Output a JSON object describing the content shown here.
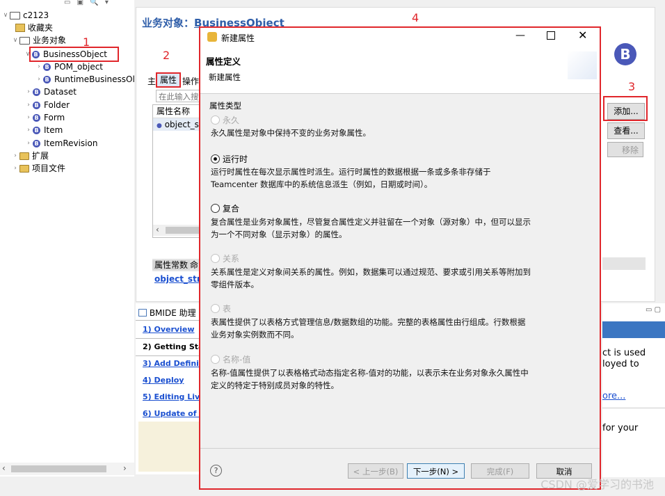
{
  "tree": {
    "root": "c2123",
    "items": [
      {
        "label": "收藏夹"
      },
      {
        "label": "业务对象"
      },
      {
        "label": "BusinessObject"
      },
      {
        "label": "POM_object"
      },
      {
        "label": "RuntimeBusinessOl"
      },
      {
        "label": "Dataset"
      },
      {
        "label": "Folder"
      },
      {
        "label": "Form"
      },
      {
        "label": "Item"
      },
      {
        "label": "ItemRevision"
      },
      {
        "label": "扩展"
      },
      {
        "label": "项目文件"
      }
    ]
  },
  "editor": {
    "title_prefix": "业务对象：",
    "title_name": "BusinessObject",
    "tab_main": "主",
    "tab_attributes": "属性",
    "tab_operations": "操作",
    "search_placeholder": "在此输入搜",
    "column_attr_name": "属性名称",
    "row_first": "object_s",
    "subtab_constants": "属性常数",
    "subtab_next": "命",
    "link_object_str": "object_stri",
    "buttons": {
      "add": "添加...",
      "view": "查看...",
      "remove": "移除"
    }
  },
  "help_panel": {
    "title": "BMIDE 助理",
    "links": [
      "1) Overview",
      "2) Getting Star",
      "3) Add Definiti",
      "4) Deploy",
      "5) Editing Live",
      "6) Update of B"
    ]
  },
  "right_help": {
    "line1": "ct is used",
    "line2": "loyed to",
    "link_more": "ore...",
    "line3": "for your"
  },
  "dialog": {
    "title": "新建属性",
    "header_title": "属性定义",
    "header_subtitle": "新建属性",
    "group_label": "属性类型",
    "options": [
      {
        "label": "永久",
        "enabled": false,
        "checked": false,
        "desc": "永久属性是对象中保持不变的业务对象属性。"
      },
      {
        "label": "运行时",
        "enabled": true,
        "checked": true,
        "desc": "运行时属性在每次显示属性时派生。运行时属性的数据根据一条或多条非存储于 Teamcenter 数据库中的系统信息派生（例如，日期或时间）。"
      },
      {
        "label": "复合",
        "enabled": true,
        "checked": false,
        "desc": "复合属性是业务对象属性，尽管复合属性定义并驻留在一个对象（源对象）中，但可以显示为一个不同对象（显示对象）的属性。"
      },
      {
        "label": "关系",
        "enabled": false,
        "checked": false,
        "desc": "关系属性是定义对象间关系的属性。例如，数据集可以通过规范、要求或引用关系等附加到零组件版本。"
      },
      {
        "label": "表",
        "enabled": false,
        "checked": false,
        "desc": "表属性提供了以表格方式管理信息/数据数组的功能。完整的表格属性由行组成。行数根据业务对象实例数而不同。"
      },
      {
        "label": "名称-值",
        "enabled": false,
        "checked": false,
        "desc": "名称-值属性提供了以表格格式动态指定名称-值对的功能，以表示未在业务对象永久属性中定义的特定于特别成员对象的特性。"
      }
    ],
    "buttons": {
      "back": "< 上一步(B)",
      "next": "下一步(N) >",
      "finish": "完成(F)",
      "cancel": "取消"
    }
  },
  "annotations": [
    "1",
    "2",
    "3",
    "4"
  ],
  "watermark": "CSDN @爱学习的书池",
  "colors": {
    "accent_red": "#e0262b",
    "title_blue": "#2f5ea9",
    "link_blue": "#1a4fd0",
    "bo_icon": "#4a58b8"
  }
}
